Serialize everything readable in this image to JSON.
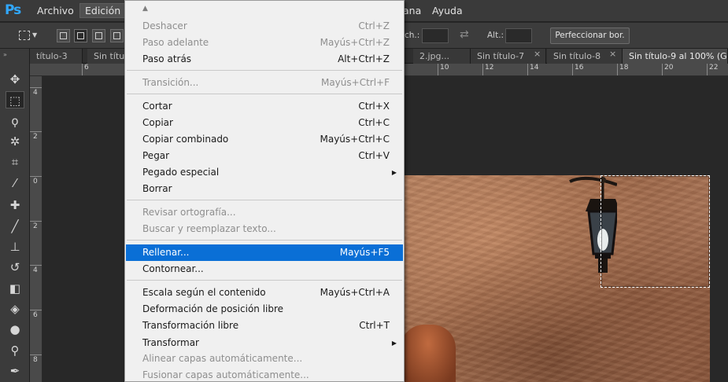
{
  "app": {
    "logo": "Ps"
  },
  "menubar": {
    "items": [
      "Archivo",
      "Edición",
      "ana",
      "Ayuda"
    ]
  },
  "options": {
    "width_label": "ch.:",
    "height_label": "Alt.:",
    "refine_button": "Perfeccionar bor."
  },
  "tabs": [
    {
      "label": "título-3"
    },
    {
      "label": "Sin títul"
    },
    {
      "label": "2.jpg..."
    },
    {
      "label": "Sin título-7"
    },
    {
      "label": "Sin título-8"
    },
    {
      "label": "Sin título-9 al 100% (G"
    }
  ],
  "rulers": {
    "top": [
      "6",
      "10",
      "12",
      "14",
      "16",
      "18",
      "20",
      "22"
    ],
    "left": [
      "4",
      "2",
      "0",
      "2",
      "4",
      "6",
      "8"
    ]
  },
  "edit_menu": {
    "items": [
      {
        "label": "Deshacer",
        "shortcut": "Ctrl+Z",
        "disabled": true
      },
      {
        "label": "Paso adelante",
        "shortcut": "Mayús+Ctrl+Z",
        "disabled": true
      },
      {
        "label": "Paso atrás",
        "shortcut": "Alt+Ctrl+Z",
        "disabled": false
      },
      {
        "label": "Transición...",
        "shortcut": "Mayús+Ctrl+F",
        "disabled": true
      },
      {
        "label": "Cortar",
        "shortcut": "Ctrl+X",
        "disabled": false
      },
      {
        "label": "Copiar",
        "shortcut": "Ctrl+C",
        "disabled": false
      },
      {
        "label": "Copiar combinado",
        "shortcut": "Mayús+Ctrl+C",
        "disabled": false
      },
      {
        "label": "Pegar",
        "shortcut": "Ctrl+V",
        "disabled": false
      },
      {
        "label": "Pegado especial",
        "shortcut": "",
        "disabled": false,
        "submenu": true
      },
      {
        "label": "Borrar",
        "shortcut": "",
        "disabled": false
      },
      {
        "label": "Revisar ortografía...",
        "shortcut": "",
        "disabled": true
      },
      {
        "label": "Buscar y reemplazar texto...",
        "shortcut": "",
        "disabled": true
      },
      {
        "label": "Rellenar...",
        "shortcut": "Mayús+F5",
        "disabled": false,
        "highlighted": true
      },
      {
        "label": "Contornear...",
        "shortcut": "",
        "disabled": false
      },
      {
        "label": "Escala según el contenido",
        "shortcut": "Mayús+Ctrl+A",
        "disabled": false
      },
      {
        "label": "Deformación de posición libre",
        "shortcut": "",
        "disabled": false
      },
      {
        "label": "Transformación libre",
        "shortcut": "Ctrl+T",
        "disabled": false
      },
      {
        "label": "Transformar",
        "shortcut": "",
        "disabled": false,
        "submenu": true
      },
      {
        "label": "Alinear capas automáticamente...",
        "shortcut": "",
        "disabled": true
      },
      {
        "label": "Fusionar capas automáticamente...",
        "shortcut": "",
        "disabled": true
      }
    ]
  },
  "tools": [
    "move-tool",
    "rectangular-marquee-tool",
    "lasso-tool",
    "magic-wand-tool",
    "crop-tool",
    "eyedropper-tool",
    "healing-brush-tool",
    "brush-tool",
    "clone-stamp-tool",
    "history-brush-tool",
    "eraser-tool",
    "paint-bucket-tool",
    "blur-tool",
    "dodge-tool",
    "pen-tool"
  ]
}
